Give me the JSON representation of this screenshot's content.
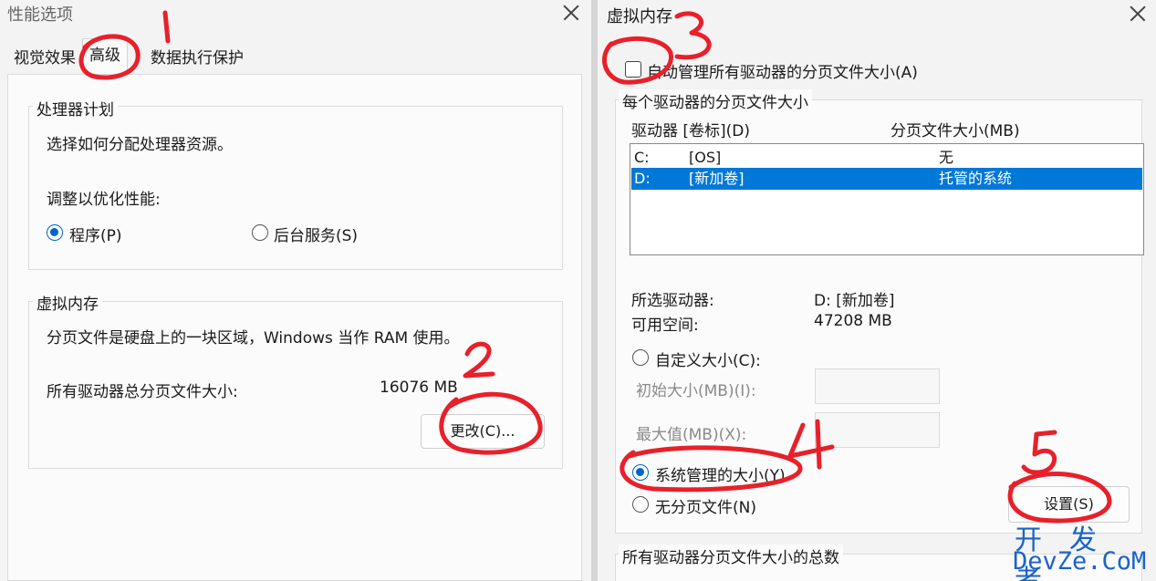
{
  "left_window": {
    "title": "性能选项",
    "tabs": [
      "视觉效果",
      "高级",
      "数据执行保护"
    ],
    "processor_group": {
      "legend": "处理器计划",
      "desc": "选择如何分配处理器资源。",
      "adjust_label": "调整以优化性能:",
      "option_programs": "程序(P)",
      "option_background": "后台服务(S)",
      "selected": "程序(P)"
    },
    "vm_group": {
      "legend": "虚拟内存",
      "desc": "分页文件是硬盘上的一块区域，Windows 当作 RAM 使用。",
      "total_label": "所有驱动器总分页文件大小:",
      "total_value": "16076 MB",
      "change_button": "更改(C)..."
    }
  },
  "right_window": {
    "title": "虚拟内存",
    "auto_manage_label": "自动管理所有驱动器的分页文件大小(A)",
    "auto_manage_checked": false,
    "per_drive_group": {
      "legend": "每个驱动器的分页文件大小",
      "col_drive": "驱动器 [卷标](D)",
      "col_size": "分页文件大小(MB)",
      "rows": [
        {
          "drive": "C:",
          "label": "[OS]",
          "size": "无",
          "selected": false
        },
        {
          "drive": "D:",
          "label": "[新加卷]",
          "size": "托管的系统",
          "selected": true
        }
      ],
      "selected_drive_label": "所选驱动器:",
      "selected_drive_value": "D:  [新加卷]",
      "free_space_label": "可用空间:",
      "free_space_value": "47208 MB",
      "custom_size": "自定义大小(C):",
      "initial_size_label": "初始大小(MB)(I):",
      "max_size_label": "最大值(MB)(X):",
      "system_managed": "系统管理的大小(Y)",
      "no_paging": "无分页文件(N)",
      "selected_option": "系统管理的大小(Y)",
      "set_button": "设置(S)"
    },
    "total_group_legend": "所有驱动器分页文件大小的总数"
  },
  "annotations": [
    "1",
    "2",
    "3",
    "4",
    "5"
  ],
  "watermark": {
    "line1": "开 发 者",
    "line2": "DevZe.CoM"
  },
  "colors": {
    "accent": "#0067c0",
    "selection": "#0078d7",
    "annotation": "#e8202a"
  }
}
